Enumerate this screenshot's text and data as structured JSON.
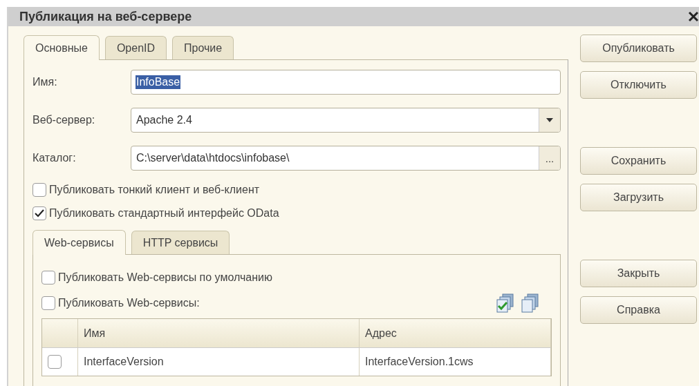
{
  "window": {
    "title": "Публикация на веб-сервере"
  },
  "tabs": [
    {
      "label": "Основные",
      "selected": true
    },
    {
      "label": "OpenID",
      "selected": false
    },
    {
      "label": "Прочие",
      "selected": false
    }
  ],
  "fields": [
    {
      "kind": "text",
      "label": "Имя:",
      "value": "InfoBase",
      "highlighted": true
    },
    {
      "kind": "dropdown",
      "label": "Веб-сервер:",
      "value": "Apache 2.4"
    },
    {
      "kind": "browse",
      "label": "Каталог:",
      "value": "C:\\server\\data\\htdocs\\infobase\\",
      "button": "..."
    }
  ],
  "options": [
    {
      "label": "Публиковать тонкий клиент и веб-клиент",
      "checked": false
    },
    {
      "label": "Публиковать стандартный интерфейс OData",
      "checked": true
    }
  ],
  "inner_tabs": [
    {
      "label": "Web-сервисы",
      "selected": true
    },
    {
      "label": "HTTP сервисы",
      "selected": false
    }
  ],
  "inner_options": [
    {
      "label": "Публиковать Web-сервисы по умолчанию",
      "checked": false
    },
    {
      "label": "Публиковать Web-сервисы:",
      "checked": false
    }
  ],
  "table": {
    "columns": [
      "Имя",
      "Адрес"
    ],
    "rows": [
      {
        "checked": false,
        "name": "InterfaceVersion",
        "address": "InterfaceVersion.1cws"
      }
    ]
  },
  "button_groups": [
    [
      "Опубликовать",
      "Отключить"
    ],
    [
      "Сохранить",
      "Загрузить"
    ],
    [
      "Закрыть",
      "Справка"
    ]
  ]
}
